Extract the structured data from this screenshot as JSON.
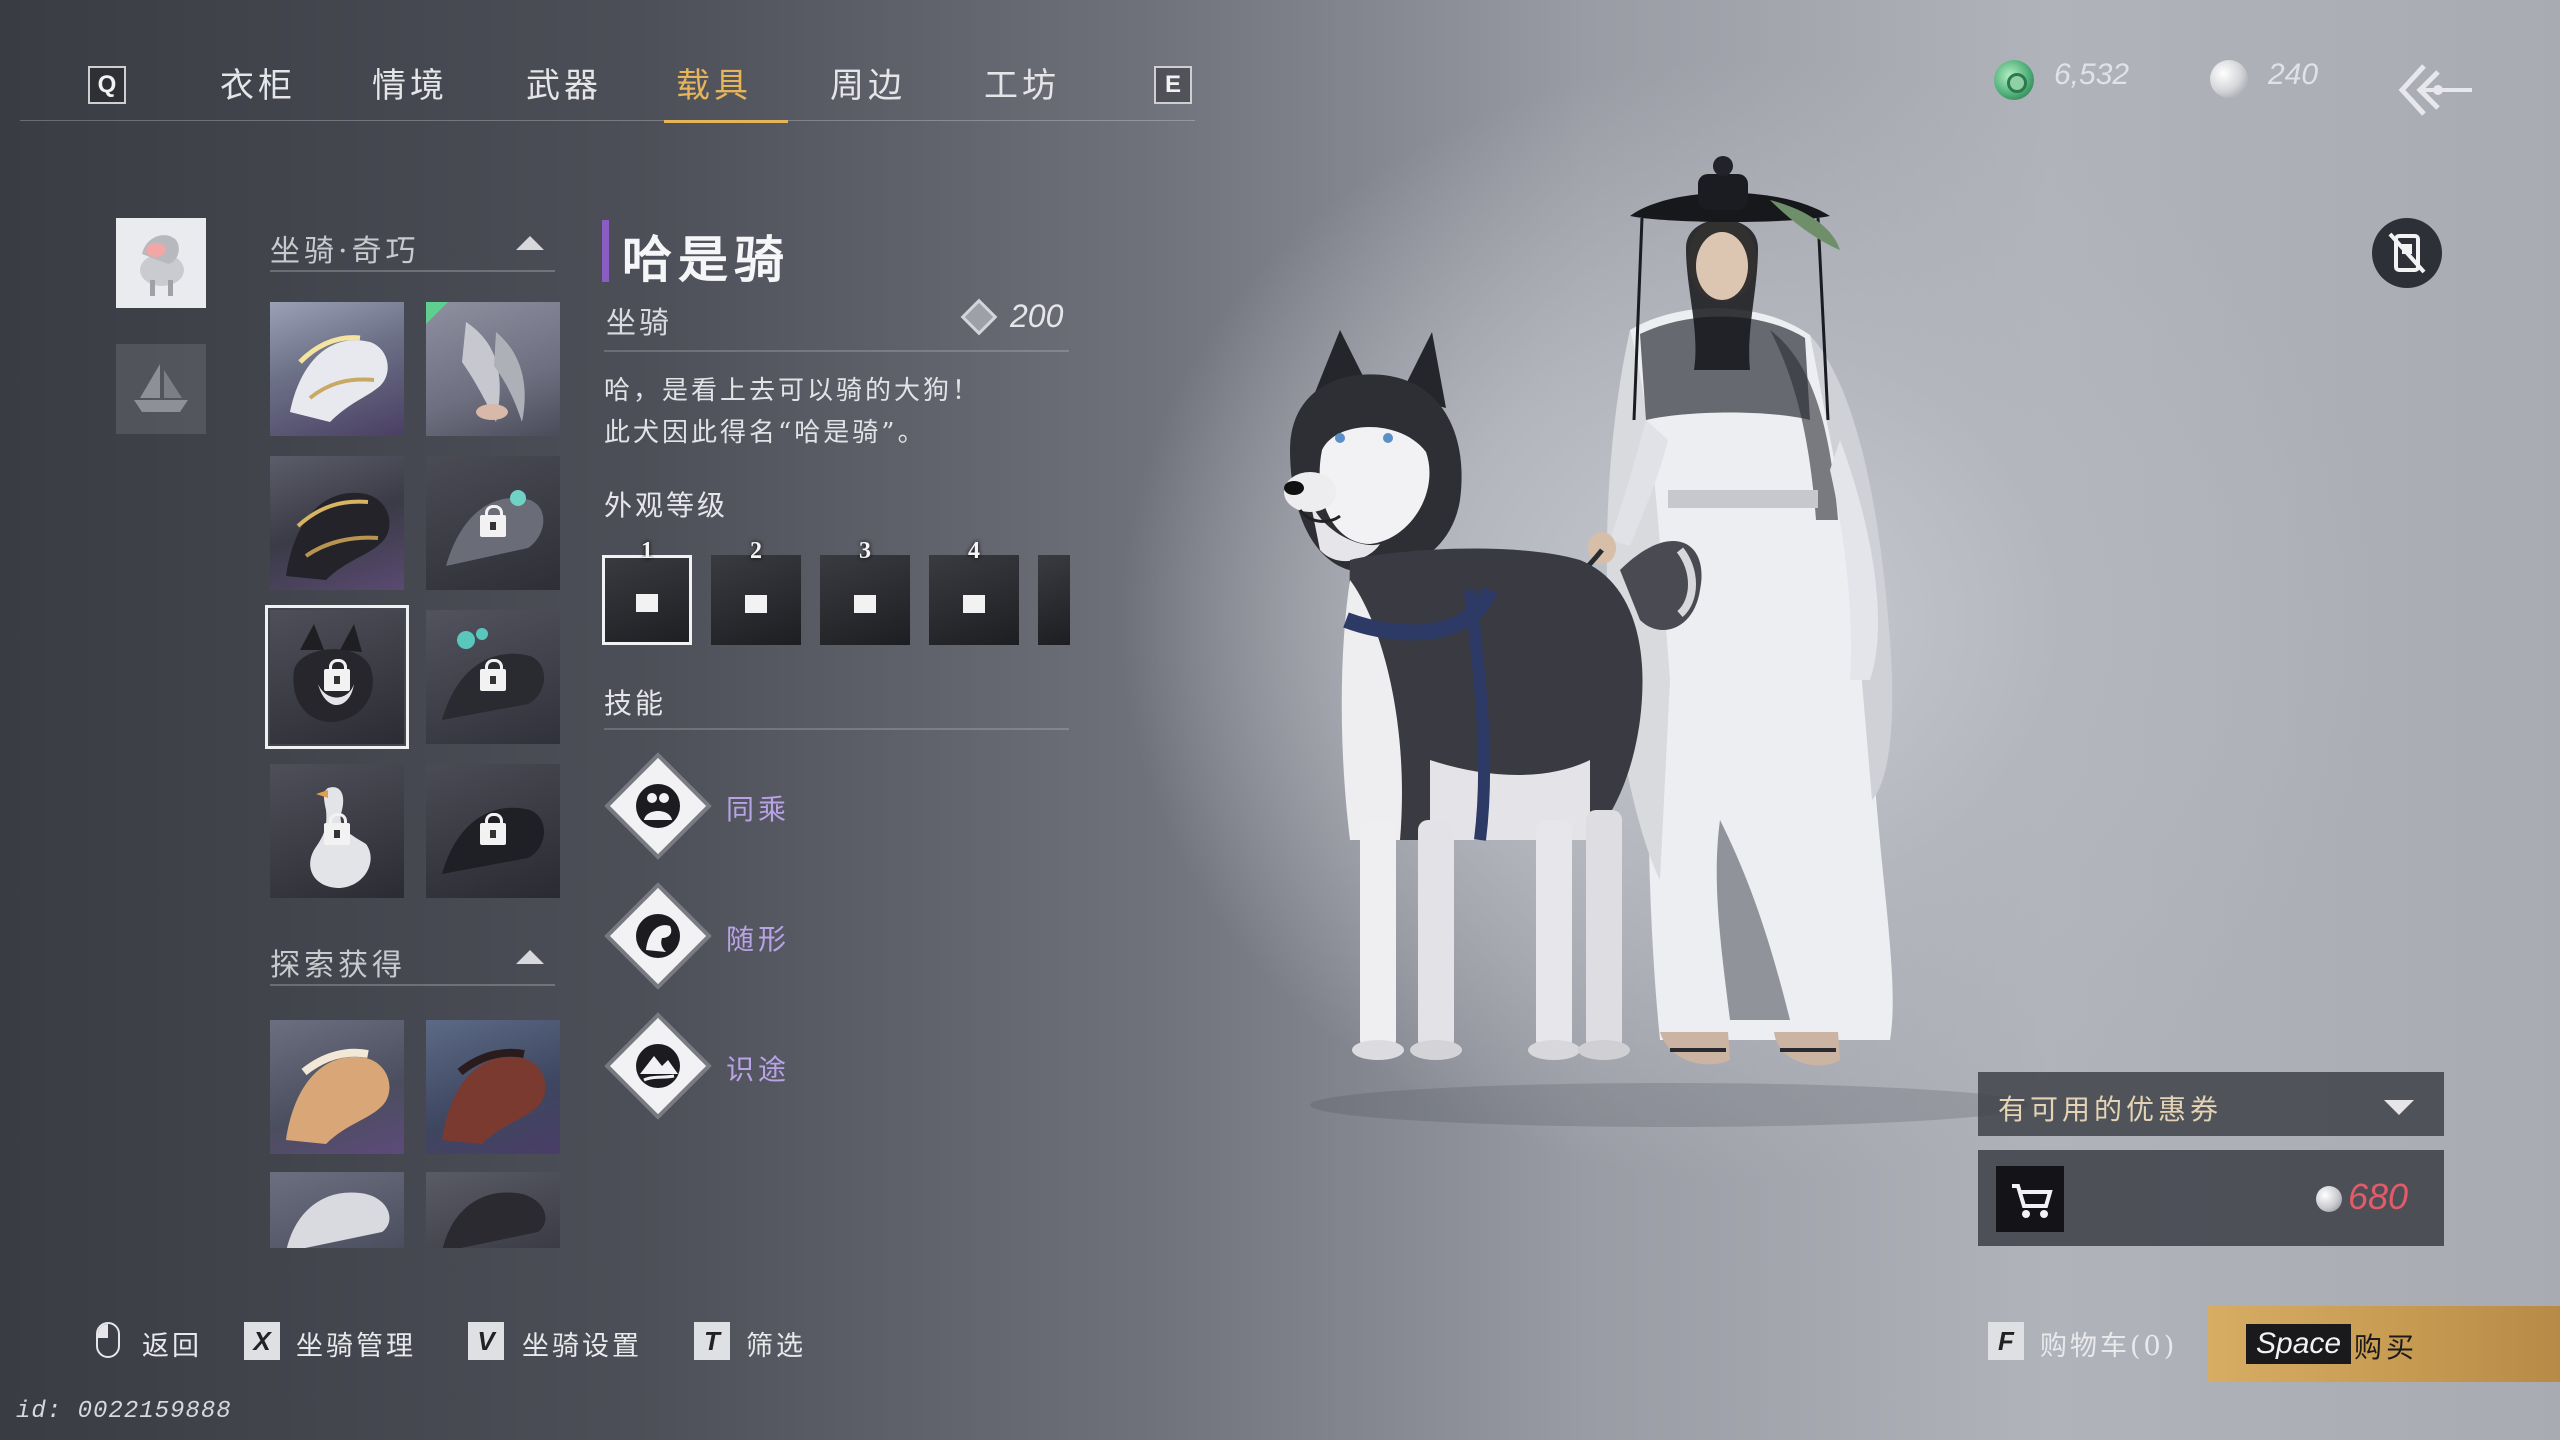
{
  "nav": {
    "prev_key": "Q",
    "next_key": "E",
    "tabs": [
      {
        "label": "衣柜"
      },
      {
        "label": "情境"
      },
      {
        "label": "武器"
      },
      {
        "label": "载具"
      },
      {
        "label": "周边"
      },
      {
        "label": "工坊"
      }
    ],
    "active_tab": "载具"
  },
  "currency": {
    "jade": "6,532",
    "pearl": "240"
  },
  "sections": {
    "mounts_title": "坐骑·奇巧",
    "explore_title": "探索获得"
  },
  "item": {
    "name": "哈是骑",
    "type": "坐骑",
    "score": "200",
    "desc_line1": "哈，是看上去可以骑的大狗！",
    "desc_line2": "此犬因此得名“哈是骑”。",
    "appearance_label": "外观等级",
    "levels": [
      "1",
      "2",
      "3",
      "4"
    ],
    "skills_label": "技能",
    "skills": [
      {
        "name": "同乘",
        "icon": "double-rider-icon"
      },
      {
        "name": "随形",
        "icon": "horse-head-icon"
      },
      {
        "name": "识途",
        "icon": "mountain-path-icon"
      }
    ]
  },
  "purchase": {
    "coupon_label": "有可用的优惠券",
    "price": "680"
  },
  "hints": {
    "back_label": "返回",
    "manage_key": "X",
    "manage_label": "坐骑管理",
    "settings_key": "V",
    "settings_label": "坐骑设置",
    "filter_key": "T",
    "filter_label": "筛选",
    "cart_key": "F",
    "cart_label": "购物车(0)",
    "buy_key": "Space",
    "buy_label": "购买"
  },
  "footer": {
    "id": "id: 0022159888"
  },
  "colors": {
    "accent_gold": "#e6b55a",
    "purple_accent": "#8b5cc2",
    "skill_purple": "#b9a3e6",
    "price_red": "#e25b69"
  }
}
